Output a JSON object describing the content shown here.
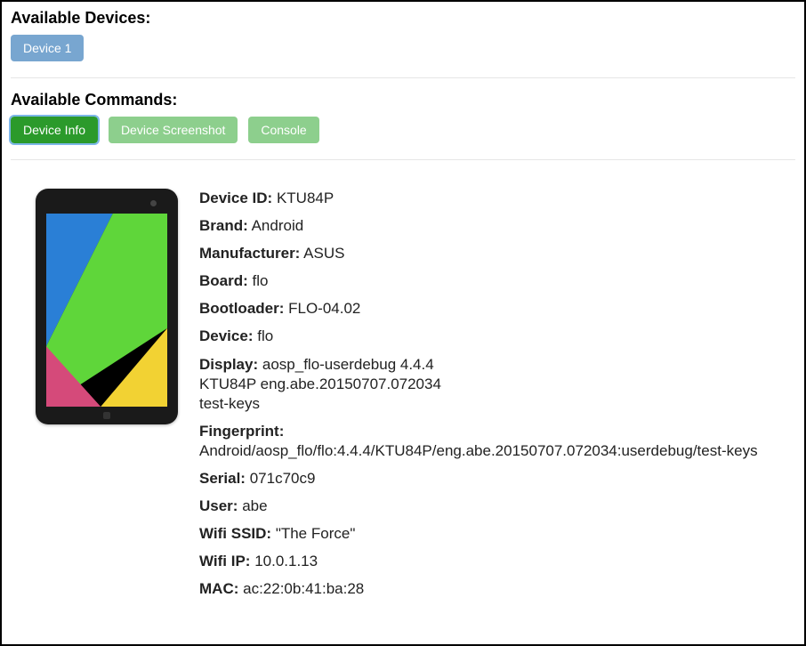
{
  "devices": {
    "heading": "Available Devices:",
    "items": [
      {
        "label": "Device 1"
      }
    ]
  },
  "commands": {
    "heading": "Available Commands:",
    "items": [
      {
        "label": "Device Info",
        "active": true
      },
      {
        "label": "Device Screenshot",
        "active": false
      },
      {
        "label": "Console",
        "active": false
      }
    ]
  },
  "info": {
    "device_id": {
      "label": "Device ID:",
      "value": "KTU84P"
    },
    "brand": {
      "label": "Brand:",
      "value": "Android"
    },
    "manufacturer": {
      "label": "Manufacturer:",
      "value": "ASUS"
    },
    "board": {
      "label": "Board:",
      "value": "flo"
    },
    "bootloader": {
      "label": "Bootloader:",
      "value": "FLO-04.02"
    },
    "device": {
      "label": "Device:",
      "value": "flo"
    },
    "display": {
      "label": "Display:",
      "value": "aosp_flo-userdebug 4.4.4 KTU84P eng.abe.20150707.072034 test-keys"
    },
    "fingerprint": {
      "label": "Fingerprint:",
      "value": "Android/aosp_flo/flo:4.4.4/KTU84P/eng.abe.20150707.072034:userdebug/test-keys"
    },
    "serial": {
      "label": "Serial:",
      "value": "071c70c9"
    },
    "user": {
      "label": "User:",
      "value": "abe"
    },
    "wifi_ssid": {
      "label": "Wifi SSID:",
      "value": "\"The Force\""
    },
    "wifi_ip": {
      "label": "Wifi IP:",
      "value": "10.0.1.13"
    },
    "mac": {
      "label": "MAC:",
      "value": "ac:22:0b:41:ba:28"
    }
  }
}
